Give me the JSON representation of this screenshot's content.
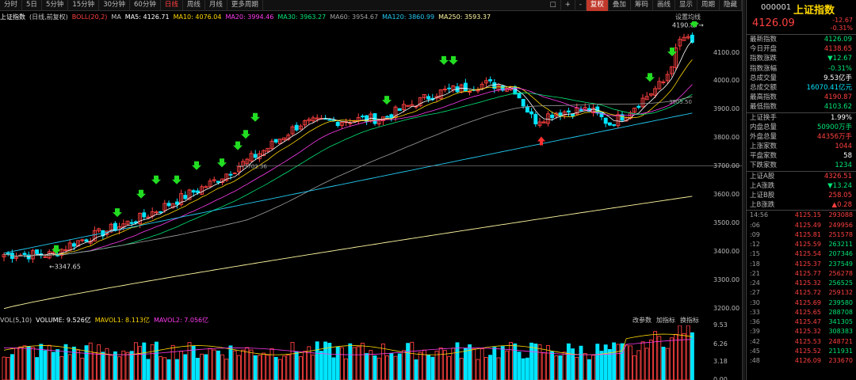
{
  "toolbar": {
    "periods": [
      "分时",
      "5日",
      "5分钟",
      "15分钟",
      "30分钟",
      "60分钟",
      "日线",
      "周线",
      "月线",
      "更多周期"
    ],
    "active": "日线",
    "right": [
      "□",
      "+",
      "-",
      "复权",
      "叠加",
      "筹码",
      "画线",
      "显示",
      "周期",
      "隐藏"
    ],
    "right_active": "复权"
  },
  "info": {
    "name": "上证指数",
    "adj": "(日线,前复权)",
    "boll": "BOLL(20,2)",
    "ma": "MA",
    "ma5": "MA5: 4126.71",
    "ma10": "MA10: 4076.04",
    "ma20": "MA20: 3994.46",
    "ma30": "MA30: 3963.27",
    "ma60": "MA60: 3954.67",
    "ma120": "MA120: 3860.99",
    "ma250": "MA250: 3593.37",
    "settings": "设置均线"
  },
  "colors": {
    "ma5": "#ffffff",
    "ma10": "#ffd700",
    "ma20": "#ff3cf0",
    "ma30": "#00e676",
    "ma60": "#a0a0a0",
    "ma120": "#22c8f0",
    "ma250": "#fff8a0",
    "up": "#ff4040",
    "down": "#00e5ff"
  },
  "chart_data": {
    "type": "candlestick",
    "yticks": [
      "4100.00",
      "4000.00",
      "3900.00",
      "3800.00",
      "3700.00",
      "3600.00",
      "3500.00",
      "3400.00",
      "3300.00",
      "3200.00"
    ],
    "ylim": [
      3180,
      4210
    ],
    "annotations": {
      "high": "4190.87",
      "low": "3347.65",
      "ma_line": "3702.36",
      "ma_line2": "3905.50"
    }
  },
  "volume": {
    "label": "VOL(5,10)",
    "volume": "VOLUME: 9.526亿",
    "mavol1": "MAVOL1: 8.113亿",
    "mavol2": "MAVOL2: 7.056亿",
    "buttons": [
      "改参数",
      "加指标",
      "换指标"
    ],
    "yticks": [
      "9.53",
      "6.26",
      "3.18",
      "0.00"
    ]
  },
  "panel": {
    "code": "000001",
    "name": "上证指数",
    "price": "4126.09",
    "change": "-12.67",
    "change_pct": "-0.31%",
    "stats": [
      {
        "l": "最新指数",
        "v": "4126.09",
        "c": "green"
      },
      {
        "l": "今日开盘",
        "v": "4138.65",
        "c": "red"
      },
      {
        "l": "指数涨跌",
        "v": "▼12.67",
        "c": "green"
      },
      {
        "l": "指数涨幅",
        "v": "-0.31%",
        "c": "green"
      },
      {
        "l": "总成交量",
        "v": "9.53亿手",
        "c": "white"
      },
      {
        "l": "总成交额",
        "v": "16070.41亿元",
        "c": "cyan"
      },
      {
        "l": "最高指数",
        "v": "4190.87",
        "c": "red"
      },
      {
        "l": "最低指数",
        "v": "4103.62",
        "c": "green"
      }
    ],
    "stats2": [
      {
        "l": "上证换手",
        "v": "1.99%",
        "c": "white"
      },
      {
        "l": "内盘总量",
        "v": "50900万手",
        "c": "green"
      },
      {
        "l": "外盘总量",
        "v": "44356万手",
        "c": "red"
      },
      {
        "l": "上涨家数",
        "v": "1044",
        "c": "red"
      },
      {
        "l": "平盘家数",
        "v": "58",
        "c": "white"
      },
      {
        "l": "下跌家数",
        "v": "1234",
        "c": "green"
      }
    ],
    "stats3": [
      {
        "l": "上证A股",
        "v": "4326.51",
        "c": "red"
      },
      {
        "l": "上A涨跌",
        "v": "▼13.24",
        "c": "green"
      },
      {
        "l": "上证B股",
        "v": "258.05",
        "c": "red"
      },
      {
        "l": "上B涨跌",
        "v": "▲0.28",
        "c": "red"
      }
    ],
    "ticks": [
      {
        "t": "14:56",
        "p": "4125.15",
        "v": "293088",
        "c": "red"
      },
      {
        "t": ":06",
        "p": "4125.49",
        "v": "249956",
        "c": "red"
      },
      {
        "t": ":09",
        "p": "4125.81",
        "v": "251578",
        "c": "red"
      },
      {
        "t": ":12",
        "p": "4125.59",
        "v": "263211",
        "c": "green"
      },
      {
        "t": ":15",
        "p": "4125.54",
        "v": "207346",
        "c": "green"
      },
      {
        "t": ":18",
        "p": "4125.37",
        "v": "237549",
        "c": "green"
      },
      {
        "t": ":21",
        "p": "4125.77",
        "v": "256278",
        "c": "red"
      },
      {
        "t": ":24",
        "p": "4125.32",
        "v": "256525",
        "c": "green"
      },
      {
        "t": ":27",
        "p": "4125.72",
        "v": "259132",
        "c": "red"
      },
      {
        "t": ":30",
        "p": "4125.69",
        "v": "239580",
        "c": "green"
      },
      {
        "t": ":33",
        "p": "4125.65",
        "v": "288708",
        "c": "green"
      },
      {
        "t": ":36",
        "p": "4125.47",
        "v": "341305",
        "c": "green"
      },
      {
        "t": ":39",
        "p": "4125.32",
        "v": "308383",
        "c": "green"
      },
      {
        "t": ":42",
        "p": "4125.53",
        "v": "248721",
        "c": "red"
      },
      {
        "t": ":45",
        "p": "4125.52",
        "v": "211931",
        "c": "green"
      },
      {
        "t": ":48",
        "p": "4126.09",
        "v": "233670",
        "c": "red"
      }
    ]
  }
}
